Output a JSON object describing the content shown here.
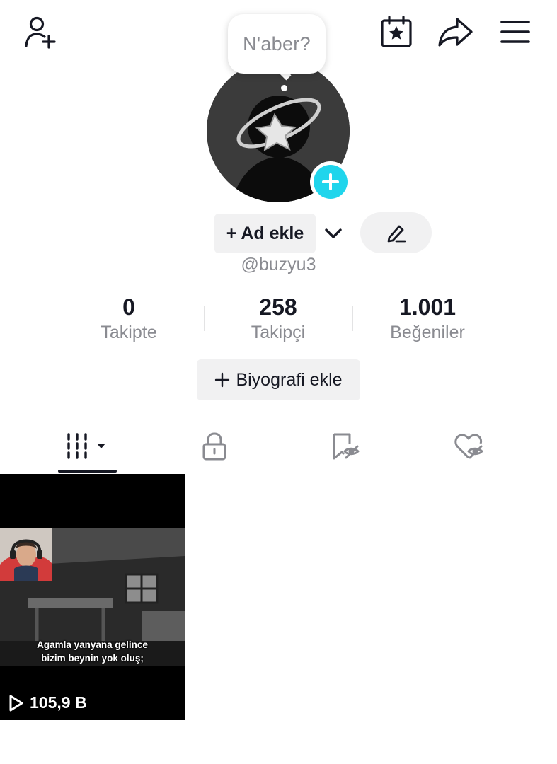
{
  "note": {
    "text": "N'aber?"
  },
  "profile": {
    "name_button": "+ Ad ekle",
    "username": "@buzyu3",
    "bio_button": "Biyografi ekle"
  },
  "stats": [
    {
      "value": "0",
      "label": "Takipte"
    },
    {
      "value": "258",
      "label": "Takipçi"
    },
    {
      "value": "1.001",
      "label": "Beğeniler"
    }
  ],
  "tabs": [
    {
      "icon": "grid-videos-icon",
      "active": true
    },
    {
      "icon": "lock-icon",
      "active": false
    },
    {
      "icon": "bookmark-hidden-icon",
      "active": false
    },
    {
      "icon": "heart-hidden-icon",
      "active": false
    }
  ],
  "video": {
    "caption_line1": "Agamla yanyana gelince",
    "caption_line2": "bizim beynin yok oluş;",
    "views": "105,9 B"
  },
  "colors": {
    "accent": "#20d5ec",
    "text": "#161823",
    "muted": "#8a8b91",
    "chip": "#f1f1f2"
  }
}
